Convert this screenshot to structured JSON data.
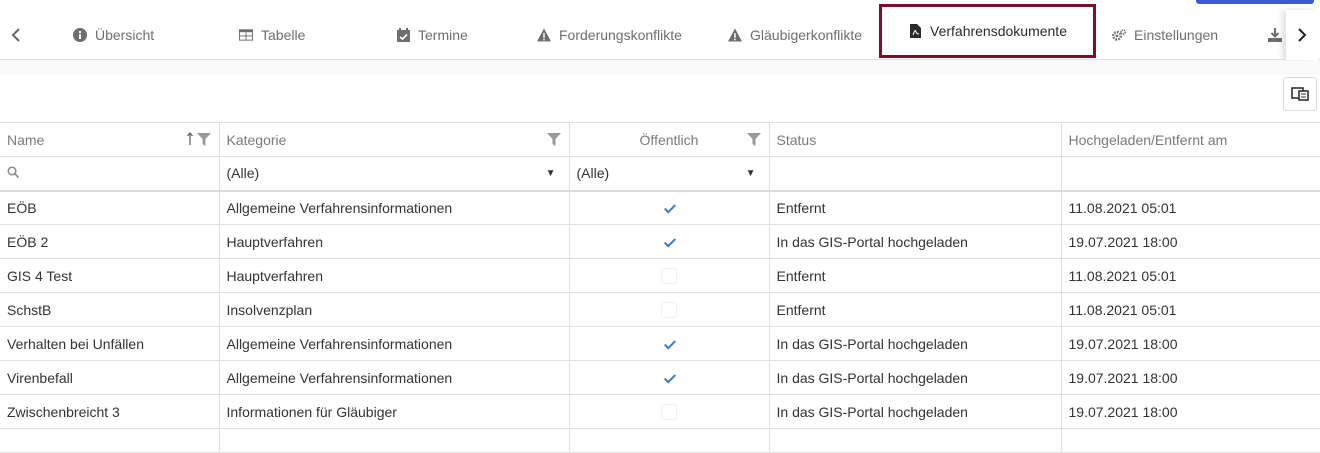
{
  "tabs": [
    {
      "label": "Übersicht",
      "icon": "info-circle-icon"
    },
    {
      "label": "Tabelle",
      "icon": "table-icon"
    },
    {
      "label": "Termine",
      "icon": "calendar-check-icon"
    },
    {
      "label": "Forderungskonflikte",
      "icon": "warning-triangle-icon"
    },
    {
      "label": "Gläubigerkonflikte",
      "icon": "warning-triangle-icon"
    },
    {
      "label": "Verfahrensdokumente",
      "icon": "pdf-file-icon",
      "active": true
    },
    {
      "label": "Einstellungen",
      "icon": "gears-icon"
    }
  ],
  "columns": {
    "name": "Name",
    "category": "Kategorie",
    "public": "Öffentlich",
    "status": "Status",
    "uploaded": "Hochgeladen/Entfernt am"
  },
  "filters": {
    "category": "(Alle)",
    "public": "(Alle)"
  },
  "rows": [
    {
      "name": "EÖB",
      "category": "Allgemeine Verfahrensinformationen",
      "public": true,
      "status": "Entfernt",
      "date": "11.08.2021 05:01"
    },
    {
      "name": "EÖB 2",
      "category": "Hauptverfahren",
      "public": true,
      "status": "In das GIS-Portal hochgeladen",
      "date": "19.07.2021 18:00"
    },
    {
      "name": "GIS 4 Test",
      "category": "Hauptverfahren",
      "public": false,
      "status": "Entfernt",
      "date": "11.08.2021 05:01"
    },
    {
      "name": "SchstB",
      "category": "Insolvenzplan",
      "public": false,
      "status": "Entfernt",
      "date": "11.08.2021 05:01"
    },
    {
      "name": "Verhalten bei Unfällen",
      "category": "Allgemeine Verfahrensinformationen",
      "public": true,
      "status": "In das GIS-Portal hochgeladen",
      "date": "19.07.2021 18:00"
    },
    {
      "name": "Virenbefall",
      "category": "Allgemeine Verfahrensinformationen",
      "public": true,
      "status": "In das GIS-Portal hochgeladen",
      "date": "19.07.2021 18:00"
    },
    {
      "name": "Zwischenbreicht 3",
      "category": "Informationen für Gläubiger",
      "public": false,
      "status": "In das GIS-Portal hochgeladen",
      "date": "19.07.2021 18:00"
    }
  ],
  "colors": {
    "active_tab_border": "#7a1128",
    "check": "#3a78c9"
  }
}
